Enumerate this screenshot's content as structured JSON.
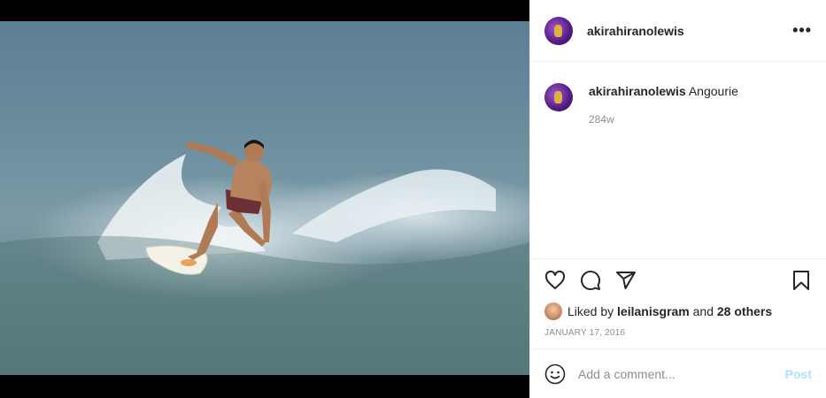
{
  "post": {
    "username": "akirahiranolewis",
    "caption": {
      "username": "akirahiranolewis",
      "text": "Angourie",
      "time_ago": "284w"
    },
    "likes": {
      "liked_by_prefix": "Liked by",
      "liked_by_user": "leilanisgram",
      "and_text": "and",
      "others": "28 others"
    },
    "date": "JANUARY 17, 2016",
    "comment": {
      "placeholder": "Add a comment...",
      "post_label": "Post"
    },
    "icons": {
      "more": "more-options-icon",
      "like": "heart-icon",
      "comment": "comment-icon",
      "share": "share-icon",
      "save": "bookmark-icon",
      "emoji": "emoji-icon"
    },
    "colors": {
      "text": "#262626",
      "muted": "#8e8e8e",
      "post_disabled": "#b2dffc"
    }
  }
}
